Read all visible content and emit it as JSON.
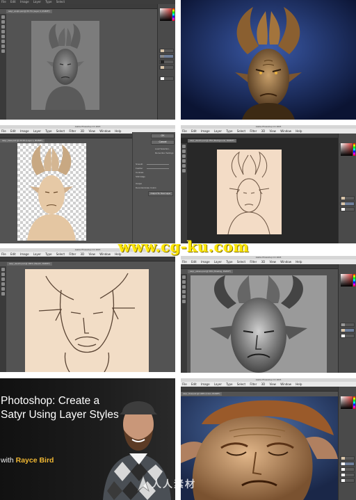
{
  "tiles": {
    "top_left": {
      "menu": [
        "File",
        "Edit",
        "Image",
        "Layer",
        "Type",
        "Select",
        "Filter",
        "3D",
        "View",
        "Window",
        "Help"
      ],
      "doc_tab": "satyr_sculpt.psd @ 66.7% (Layer 0, RGB/8*)"
    },
    "middle_left_upper": {
      "app_title": "Adobe Photoshop CC 2015",
      "menu": [
        "File",
        "Edit",
        "Image",
        "Layer",
        "Type",
        "Select",
        "Filter",
        "3D",
        "View",
        "Window",
        "Help"
      ],
      "doc_tab": "satyr_base.psd @ 33.3% (Layer 1, RGB/8*)",
      "dialog": {
        "ok": "OK",
        "cancel": "Cancel",
        "load_selection": "Load Selection...",
        "remember_settings": "Remember Settings",
        "refine_radius": "Refine Radius Tool",
        "output": "Output",
        "smooth": "Smooth",
        "feather": "Feather",
        "contrast": "Contrast",
        "shift_edge": "Shift Edge",
        "decontaminate": "Decontaminate Colors",
        "output_to": "Output To: New Layer"
      }
    },
    "middle_right_upper": {
      "app_title": "Adobe Photoshop CC 2015",
      "menu": [
        "File",
        "Edit",
        "Image",
        "Layer",
        "Type",
        "Select",
        "Filter",
        "3D",
        "View",
        "Window",
        "Help"
      ],
      "doc_tab": "satyr_sketch.psd @ 25% (Background, RGB/8*)"
    },
    "middle_left_lower": {
      "app_title": "Adobe Photoshop CC 2015",
      "menu": [
        "File",
        "Edit",
        "Image",
        "Layer",
        "Type",
        "Select",
        "Filter",
        "3D",
        "View",
        "Window",
        "Help"
      ],
      "doc_tab": "satyr_sketch.psd @ 100% (Sketch, RGB/8*)"
    },
    "middle_right_lower": {
      "app_title": "Adobe Photoshop CC 2015",
      "menu": [
        "File",
        "Edit",
        "Image",
        "Layer",
        "Type",
        "Select",
        "Filter",
        "3D",
        "View",
        "Window",
        "Help"
      ],
      "doc_tab": "satyr_values.psd @ 50% (Shading, RGB/8*)"
    },
    "bottom_right": {
      "app_title": "Adobe Photoshop CC 2015",
      "menu": [
        "File",
        "Edit",
        "Image",
        "Layer",
        "Type",
        "Select",
        "Filter",
        "3D",
        "View",
        "Window",
        "Help"
      ],
      "doc_tab": "satyr_final.psd @ 100% (Color, RGB/8*)"
    }
  },
  "course": {
    "title": "Photoshop: Create a Satyr Using Layer Styles",
    "author_prefix": "with",
    "author_name": "Rayce Bird"
  },
  "watermarks": {
    "top": "www.cg-ku.com",
    "bottom": "人人素材"
  },
  "colors": {
    "ps_bg": "#535353",
    "ps_panel": "#4a4a4a",
    "night_blue": "#1b2a5e",
    "accent_gold": "#f0b733",
    "watermark_yellow": "#ffe600"
  }
}
